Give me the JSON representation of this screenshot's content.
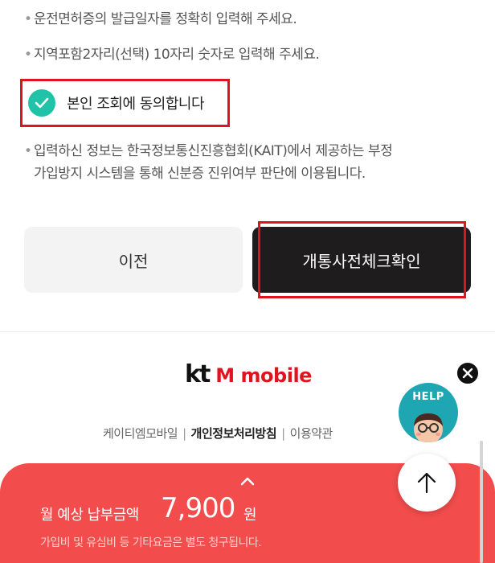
{
  "notes": {
    "note1": "운전면허증의 발급일자를 정확히 입력해 주세요.",
    "note2": "지역포함2자리(선택) 10자리 숫자로 입력해 주세요.",
    "note3_line1": "입력하신 정보는 한국정보통신진흥협회(KAIT)에서 제공하는 부정",
    "note3_line2": "가입방지 시스템을 통해 신분증 진위여부 판단에 이용됩니다.",
    "bullet": "•"
  },
  "consent": {
    "label": "본인 조회에 동의합니다",
    "checked": true,
    "icon": "check-icon"
  },
  "buttons": {
    "prev_label": "이전",
    "check_label": "개통사전체크확인"
  },
  "footer": {
    "logo_kt": "kt",
    "logo_mobile": "M mobile",
    "company": "케이티엠모바일",
    "separator": "|",
    "privacy": "개인정보처리방침",
    "terms": "이용약관"
  },
  "floating": {
    "help_label": "HELP",
    "close_icon": "close-icon",
    "top_icon": "arrow-up-icon"
  },
  "bottom_sheet": {
    "monthly_label": "월 예상 납부금액",
    "monthly_value": "7,900",
    "monthly_unit": "원",
    "fee_note": "가입비 및 유심비 등 기타요금은 별도 청구됩니다.",
    "expand_icon": "chevron-up-icon"
  },
  "colors": {
    "accent_red": "#e0141e",
    "sheet_red": "#f24c4c",
    "check_teal": "#20c3a8",
    "help_teal": "#1ea7b3",
    "dark_button": "#1e1c1c"
  }
}
